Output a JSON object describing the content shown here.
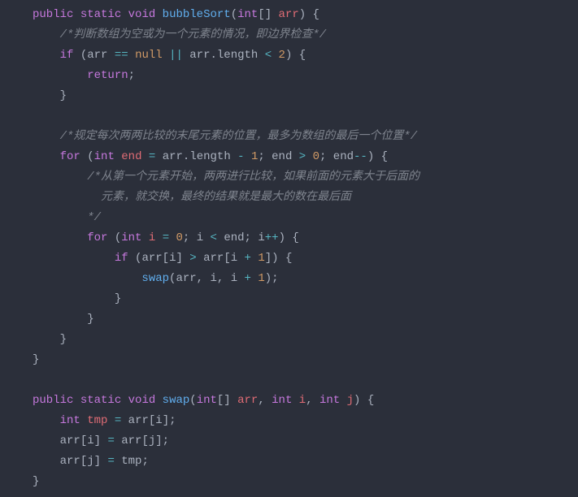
{
  "code": {
    "lines": [
      [
        {
          "cls": "tok-keyword",
          "t": "public"
        },
        {
          "cls": "tok-default",
          "t": " "
        },
        {
          "cls": "tok-keyword",
          "t": "static"
        },
        {
          "cls": "tok-default",
          "t": " "
        },
        {
          "cls": "tok-type",
          "t": "void"
        },
        {
          "cls": "tok-default",
          "t": " "
        },
        {
          "cls": "tok-func",
          "t": "bubbleSort"
        },
        {
          "cls": "tok-punc",
          "t": "("
        },
        {
          "cls": "tok-type",
          "t": "int"
        },
        {
          "cls": "tok-punc",
          "t": "[] "
        },
        {
          "cls": "tok-var",
          "t": "arr"
        },
        {
          "cls": "tok-punc",
          "t": ") {"
        }
      ],
      [
        {
          "cls": "tok-default",
          "t": "    "
        },
        {
          "cls": "tok-comment",
          "t": "/*判断数组为空或为一个元素的情况，即边界检查*/"
        }
      ],
      [
        {
          "cls": "tok-default",
          "t": "    "
        },
        {
          "cls": "tok-keyword",
          "t": "if"
        },
        {
          "cls": "tok-default",
          "t": " "
        },
        {
          "cls": "tok-punc",
          "t": "("
        },
        {
          "cls": "tok-default",
          "t": "arr "
        },
        {
          "cls": "tok-op",
          "t": "=="
        },
        {
          "cls": "tok-default",
          "t": " "
        },
        {
          "cls": "tok-num",
          "t": "null"
        },
        {
          "cls": "tok-default",
          "t": " "
        },
        {
          "cls": "tok-op",
          "t": "||"
        },
        {
          "cls": "tok-default",
          "t": " arr"
        },
        {
          "cls": "tok-punc",
          "t": "."
        },
        {
          "cls": "tok-default",
          "t": "length "
        },
        {
          "cls": "tok-op",
          "t": "<"
        },
        {
          "cls": "tok-default",
          "t": " "
        },
        {
          "cls": "tok-num",
          "t": "2"
        },
        {
          "cls": "tok-punc",
          "t": ") {"
        }
      ],
      [
        {
          "cls": "tok-default",
          "t": "        "
        },
        {
          "cls": "tok-keyword",
          "t": "return"
        },
        {
          "cls": "tok-punc",
          "t": ";"
        }
      ],
      [
        {
          "cls": "tok-default",
          "t": "    "
        },
        {
          "cls": "tok-punc",
          "t": "}"
        }
      ],
      [
        {
          "cls": "tok-default",
          "t": " "
        }
      ],
      [
        {
          "cls": "tok-default",
          "t": "    "
        },
        {
          "cls": "tok-comment",
          "t": "/*规定每次两两比较的末尾元素的位置，最多为数组的最后一个位置*/"
        }
      ],
      [
        {
          "cls": "tok-default",
          "t": "    "
        },
        {
          "cls": "tok-keyword",
          "t": "for"
        },
        {
          "cls": "tok-default",
          "t": " "
        },
        {
          "cls": "tok-punc",
          "t": "("
        },
        {
          "cls": "tok-type",
          "t": "int"
        },
        {
          "cls": "tok-default",
          "t": " "
        },
        {
          "cls": "tok-var",
          "t": "end"
        },
        {
          "cls": "tok-default",
          "t": " "
        },
        {
          "cls": "tok-op",
          "t": "="
        },
        {
          "cls": "tok-default",
          "t": " arr"
        },
        {
          "cls": "tok-punc",
          "t": "."
        },
        {
          "cls": "tok-default",
          "t": "length "
        },
        {
          "cls": "tok-op",
          "t": "-"
        },
        {
          "cls": "tok-default",
          "t": " "
        },
        {
          "cls": "tok-num",
          "t": "1"
        },
        {
          "cls": "tok-punc",
          "t": "; "
        },
        {
          "cls": "tok-default",
          "t": "end "
        },
        {
          "cls": "tok-op",
          "t": ">"
        },
        {
          "cls": "tok-default",
          "t": " "
        },
        {
          "cls": "tok-num",
          "t": "0"
        },
        {
          "cls": "tok-punc",
          "t": "; "
        },
        {
          "cls": "tok-default",
          "t": "end"
        },
        {
          "cls": "tok-op",
          "t": "--"
        },
        {
          "cls": "tok-punc",
          "t": ") {"
        }
      ],
      [
        {
          "cls": "tok-default",
          "t": "        "
        },
        {
          "cls": "tok-comment",
          "t": "/*从第一个元素开始，两两进行比较，如果前面的元素大于后面的"
        }
      ],
      [
        {
          "cls": "tok-default",
          "t": "          "
        },
        {
          "cls": "tok-comment",
          "t": "元素，就交换，最终的结果就是最大的数在最后面"
        }
      ],
      [
        {
          "cls": "tok-default",
          "t": "        "
        },
        {
          "cls": "tok-comment",
          "t": "*/"
        }
      ],
      [
        {
          "cls": "tok-default",
          "t": "        "
        },
        {
          "cls": "tok-keyword",
          "t": "for"
        },
        {
          "cls": "tok-default",
          "t": " "
        },
        {
          "cls": "tok-punc",
          "t": "("
        },
        {
          "cls": "tok-type",
          "t": "int"
        },
        {
          "cls": "tok-default",
          "t": " "
        },
        {
          "cls": "tok-var",
          "t": "i"
        },
        {
          "cls": "tok-default",
          "t": " "
        },
        {
          "cls": "tok-op",
          "t": "="
        },
        {
          "cls": "tok-default",
          "t": " "
        },
        {
          "cls": "tok-num",
          "t": "0"
        },
        {
          "cls": "tok-punc",
          "t": "; "
        },
        {
          "cls": "tok-default",
          "t": "i "
        },
        {
          "cls": "tok-op",
          "t": "<"
        },
        {
          "cls": "tok-default",
          "t": " end"
        },
        {
          "cls": "tok-punc",
          "t": "; "
        },
        {
          "cls": "tok-default",
          "t": "i"
        },
        {
          "cls": "tok-op",
          "t": "++"
        },
        {
          "cls": "tok-punc",
          "t": ") {"
        }
      ],
      [
        {
          "cls": "tok-default",
          "t": "            "
        },
        {
          "cls": "tok-keyword",
          "t": "if"
        },
        {
          "cls": "tok-default",
          "t": " "
        },
        {
          "cls": "tok-punc",
          "t": "("
        },
        {
          "cls": "tok-default",
          "t": "arr"
        },
        {
          "cls": "tok-punc",
          "t": "["
        },
        {
          "cls": "tok-default",
          "t": "i"
        },
        {
          "cls": "tok-punc",
          "t": "] "
        },
        {
          "cls": "tok-op",
          "t": ">"
        },
        {
          "cls": "tok-default",
          "t": " arr"
        },
        {
          "cls": "tok-punc",
          "t": "["
        },
        {
          "cls": "tok-default",
          "t": "i "
        },
        {
          "cls": "tok-op",
          "t": "+"
        },
        {
          "cls": "tok-default",
          "t": " "
        },
        {
          "cls": "tok-num",
          "t": "1"
        },
        {
          "cls": "tok-punc",
          "t": "]) {"
        }
      ],
      [
        {
          "cls": "tok-default",
          "t": "                "
        },
        {
          "cls": "tok-func",
          "t": "swap"
        },
        {
          "cls": "tok-punc",
          "t": "("
        },
        {
          "cls": "tok-default",
          "t": "arr"
        },
        {
          "cls": "tok-punc",
          "t": ", "
        },
        {
          "cls": "tok-default",
          "t": "i"
        },
        {
          "cls": "tok-punc",
          "t": ", "
        },
        {
          "cls": "tok-default",
          "t": "i "
        },
        {
          "cls": "tok-op",
          "t": "+"
        },
        {
          "cls": "tok-default",
          "t": " "
        },
        {
          "cls": "tok-num",
          "t": "1"
        },
        {
          "cls": "tok-punc",
          "t": ");"
        }
      ],
      [
        {
          "cls": "tok-default",
          "t": "            "
        },
        {
          "cls": "tok-punc",
          "t": "}"
        }
      ],
      [
        {
          "cls": "tok-default",
          "t": "        "
        },
        {
          "cls": "tok-punc",
          "t": "}"
        }
      ],
      [
        {
          "cls": "tok-default",
          "t": "    "
        },
        {
          "cls": "tok-punc",
          "t": "}"
        }
      ],
      [
        {
          "cls": "tok-punc",
          "t": "}"
        }
      ],
      [
        {
          "cls": "tok-default",
          "t": " "
        }
      ],
      [
        {
          "cls": "tok-keyword",
          "t": "public"
        },
        {
          "cls": "tok-default",
          "t": " "
        },
        {
          "cls": "tok-keyword",
          "t": "static"
        },
        {
          "cls": "tok-default",
          "t": " "
        },
        {
          "cls": "tok-type",
          "t": "void"
        },
        {
          "cls": "tok-default",
          "t": " "
        },
        {
          "cls": "tok-func",
          "t": "swap"
        },
        {
          "cls": "tok-punc",
          "t": "("
        },
        {
          "cls": "tok-type",
          "t": "int"
        },
        {
          "cls": "tok-punc",
          "t": "[] "
        },
        {
          "cls": "tok-var",
          "t": "arr"
        },
        {
          "cls": "tok-punc",
          "t": ", "
        },
        {
          "cls": "tok-type",
          "t": "int"
        },
        {
          "cls": "tok-default",
          "t": " "
        },
        {
          "cls": "tok-var",
          "t": "i"
        },
        {
          "cls": "tok-punc",
          "t": ", "
        },
        {
          "cls": "tok-type",
          "t": "int"
        },
        {
          "cls": "tok-default",
          "t": " "
        },
        {
          "cls": "tok-var",
          "t": "j"
        },
        {
          "cls": "tok-punc",
          "t": ") {"
        }
      ],
      [
        {
          "cls": "tok-default",
          "t": "    "
        },
        {
          "cls": "tok-type",
          "t": "int"
        },
        {
          "cls": "tok-default",
          "t": " "
        },
        {
          "cls": "tok-var",
          "t": "tmp"
        },
        {
          "cls": "tok-default",
          "t": " "
        },
        {
          "cls": "tok-op",
          "t": "="
        },
        {
          "cls": "tok-default",
          "t": " arr"
        },
        {
          "cls": "tok-punc",
          "t": "["
        },
        {
          "cls": "tok-default",
          "t": "i"
        },
        {
          "cls": "tok-punc",
          "t": "];"
        }
      ],
      [
        {
          "cls": "tok-default",
          "t": "    arr"
        },
        {
          "cls": "tok-punc",
          "t": "["
        },
        {
          "cls": "tok-default",
          "t": "i"
        },
        {
          "cls": "tok-punc",
          "t": "] "
        },
        {
          "cls": "tok-op",
          "t": "="
        },
        {
          "cls": "tok-default",
          "t": " arr"
        },
        {
          "cls": "tok-punc",
          "t": "["
        },
        {
          "cls": "tok-default",
          "t": "j"
        },
        {
          "cls": "tok-punc",
          "t": "];"
        }
      ],
      [
        {
          "cls": "tok-default",
          "t": "    arr"
        },
        {
          "cls": "tok-punc",
          "t": "["
        },
        {
          "cls": "tok-default",
          "t": "j"
        },
        {
          "cls": "tok-punc",
          "t": "] "
        },
        {
          "cls": "tok-op",
          "t": "="
        },
        {
          "cls": "tok-default",
          "t": " tmp"
        },
        {
          "cls": "tok-punc",
          "t": ";"
        }
      ],
      [
        {
          "cls": "tok-punc",
          "t": "}"
        }
      ]
    ]
  }
}
